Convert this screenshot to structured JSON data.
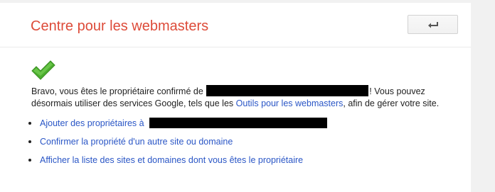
{
  "header": {
    "title": "Centre pour les webmasters",
    "back_button_icon": "back-arrow-icon"
  },
  "status_icon": "checkmark-icon",
  "colors": {
    "title": "#dd4b39",
    "link": "#2a56c6",
    "check": "#4cae2f",
    "text": "#222222"
  },
  "message": {
    "part1": "Bravo, vous êtes le propriétaire confirmé de",
    "part2": "! Vous pouvez",
    "part3": "désormais utiliser des services Google, tels que les",
    "link_label": "Outils pour les webmasters",
    "part4": ", afin de gérer votre site."
  },
  "actions": [
    {
      "label": "Ajouter des propriétaires à"
    },
    {
      "label": "Confirmer la propriété d'un autre site ou domaine"
    },
    {
      "label": "Afficher la liste des sites et domaines dont vous êtes le propriétaire"
    }
  ]
}
